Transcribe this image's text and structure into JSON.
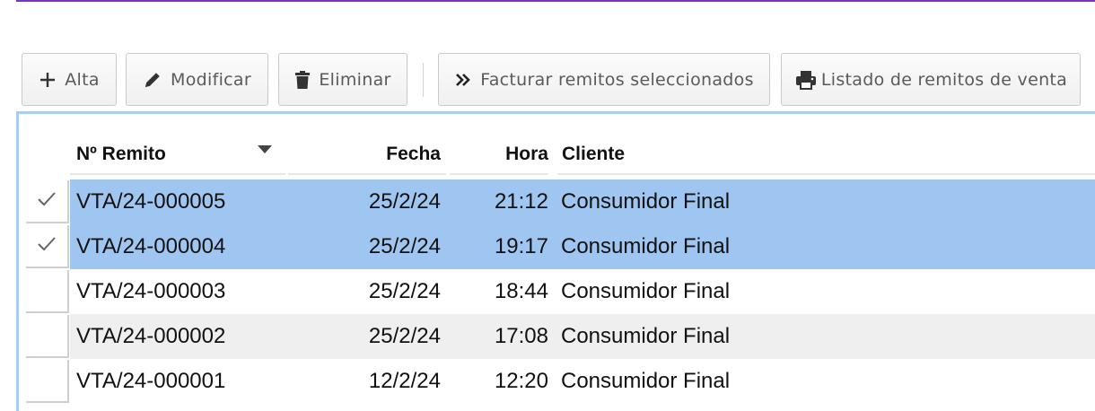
{
  "toolbar": {
    "alta_label": "Alta",
    "modificar_label": "Modificar",
    "eliminar_label": "Eliminar",
    "facturar_label": "Facturar remitos seleccionados",
    "listado_label": "Listado de remitos de venta"
  },
  "table": {
    "columns": {
      "numero": "Nº Remito",
      "fecha": "Fecha",
      "hora": "Hora",
      "cliente": "Cliente"
    },
    "rows": [
      {
        "numero": "VTA/24-000005",
        "fecha": "25/2/24",
        "hora": "21:12",
        "cliente": "Consumidor Final",
        "selected": true
      },
      {
        "numero": "VTA/24-000004",
        "fecha": "25/2/24",
        "hora": "19:17",
        "cliente": "Consumidor Final",
        "selected": true
      },
      {
        "numero": "VTA/24-000003",
        "fecha": "25/2/24",
        "hora": "18:44",
        "cliente": "Consumidor Final",
        "selected": false
      },
      {
        "numero": "VTA/24-000002",
        "fecha": "25/2/24",
        "hora": "17:08",
        "cliente": "Consumidor Final",
        "selected": false
      },
      {
        "numero": "VTA/24-000001",
        "fecha": "12/2/24",
        "hora": "12:20",
        "cliente": "Consumidor Final",
        "selected": false
      }
    ]
  },
  "colors": {
    "accent": "#7b2fd0",
    "selection": "#9fc6f1",
    "grid_border": "#a9cdf0",
    "alt_row": "#efefef"
  },
  "icons": {
    "alta": "plus-icon",
    "modificar": "pencil-icon",
    "eliminar": "trash-icon",
    "facturar": "double-chevron-right-icon",
    "listado": "printer-icon",
    "sort": "sort-descending-icon",
    "row_check": "checkmark-icon"
  }
}
